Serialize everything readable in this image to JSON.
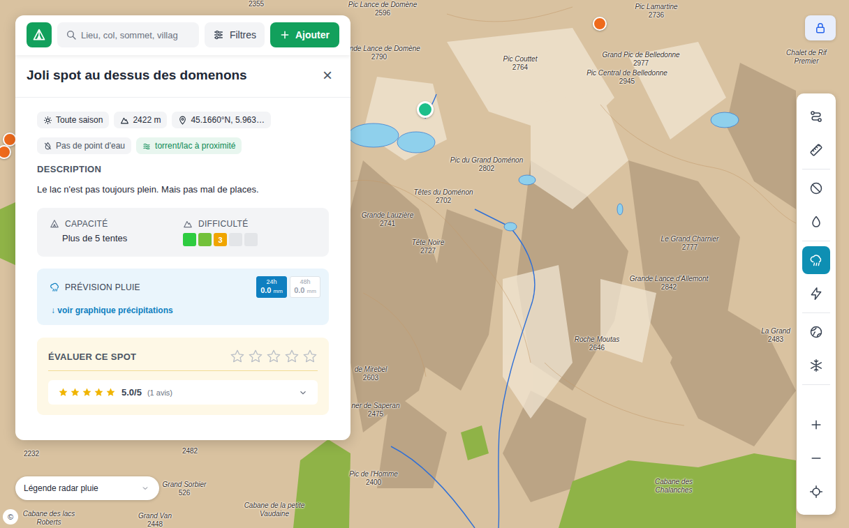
{
  "topbar": {
    "search": {
      "placeholder": "Lieu, col, sommet, villag"
    },
    "filters": "Filtres",
    "add": "Ajouter"
  },
  "spot": {
    "title": "Joli spot au dessus des domenons",
    "close": "×",
    "chips": [
      {
        "label": "Toute saison",
        "highlight": false
      },
      {
        "label": "2422 m",
        "highlight": false
      },
      {
        "label": "45.1660°N, 5.963…",
        "highlight": false
      }
    ],
    "tags": [
      {
        "label": "Pas de point d'eau",
        "highlight": false
      },
      {
        "label": "torrent/lac à proximité",
        "highlight": true
      }
    ],
    "description": {
      "heading": "DESCRIPTION",
      "text": "Le lac n'est pas toujours plein. Mais pas mal de places."
    },
    "capacity": {
      "label": "CAPACITÉ",
      "value": "Plus de 5 tentes"
    },
    "difficulty": {
      "label": "DIFFICULTÉ",
      "value": "3",
      "level": 3,
      "segments": [
        {
          "color": "#2ecc40",
          "filled": true
        },
        {
          "color": "#72c13a",
          "filled": true
        },
        {
          "color": "#f0a500",
          "filled": true
        },
        {
          "color": "#e3e5e8",
          "filled": false
        },
        {
          "color": "#e3e5e8",
          "filled": false
        }
      ]
    },
    "rain": {
      "title": "PRÉVISION PLUIE",
      "link": "↓ voir graphique précipitations",
      "tabs": [
        {
          "label": "24h",
          "value": "0.0",
          "unit": "mm",
          "selected": true
        },
        {
          "label": "48h",
          "value": "0.0",
          "unit": "mm",
          "selected": false
        }
      ]
    },
    "rating": {
      "title": "ÉVALUER CE SPOT",
      "stars": 0,
      "summary": {
        "stars": 5,
        "score": "5.0/5",
        "count": "(1 avis)",
        "expanded": false
      }
    }
  },
  "legend": {
    "label": "Légende radar pluie",
    "expanded": false
  },
  "attribution": "©",
  "markers": [
    {
      "color": "#1dbf8a",
      "selected": true
    },
    {
      "color": "#ee6a1c",
      "selected": false
    },
    {
      "color": "#ee6a1c",
      "selected": false
    },
    {
      "color": "#ee6a1c",
      "selected": false
    }
  ],
  "toolbar": {
    "groups": [
      [
        {
          "selected": false
        },
        {
          "selected": false
        }
      ],
      [
        {
          "selected": false
        },
        {
          "selected": false
        }
      ],
      [
        {
          "selected": true
        },
        {
          "selected": false
        }
      ],
      [
        {
          "selected": false
        },
        {
          "selected": false
        }
      ],
      [
        {
          "selected": false
        },
        {
          "selected": false
        },
        {
          "selected": false
        }
      ]
    ]
  },
  "labels": [
    {
      "elevation": "2355"
    },
    {
      "name": "Pic Lance de Domène",
      "elevation": "2596"
    },
    {
      "name": "Pic Lamartine",
      "elevation": "2736"
    },
    {
      "name": "Grande Lance de Domène",
      "elevation": "2790"
    },
    {
      "name": "Pic Couttet",
      "elevation": "2764"
    },
    {
      "name": "Grand Pic de Belledonne",
      "elevation": "2977"
    },
    {
      "name": "Pic Central de Belledonne",
      "elevation": "2945"
    },
    {
      "name": "Chalet de Rif Premier"
    },
    {
      "name": "Pic du Grand Doménon",
      "elevation": "2802"
    },
    {
      "name": "Têtes du Doménon",
      "elevation": "2702"
    },
    {
      "name": "Grande Lauzière",
      "elevation": "2741"
    },
    {
      "name": "Tête Noire",
      "elevation": "2727"
    },
    {
      "name": "Le Grand Charnier",
      "elevation": "2777"
    },
    {
      "name": "Grande Lance d'Allemont",
      "elevation": "2842"
    },
    {
      "name": "La Grand",
      "elevation": "2483"
    },
    {
      "name": "de Mirebel",
      "elevation": "2603"
    },
    {
      "name": "ner de Saperan",
      "elevation": "2475"
    },
    {
      "name": "Roche Moutas",
      "elevation": "2646"
    },
    {
      "name": "Pic de l'Homme",
      "elevation": "2400"
    },
    {
      "name": "Cabane des Chalanches"
    },
    {
      "elevation": "2232"
    },
    {
      "elevation": "2482"
    },
    {
      "name": "Grand Sorbier",
      "elevation": "526"
    },
    {
      "name": "Cabane de la petite Vaudaine"
    },
    {
      "name": "Grand Van",
      "elevation": "2448"
    },
    {
      "name": "Cabane des lacs Roberts"
    }
  ]
}
